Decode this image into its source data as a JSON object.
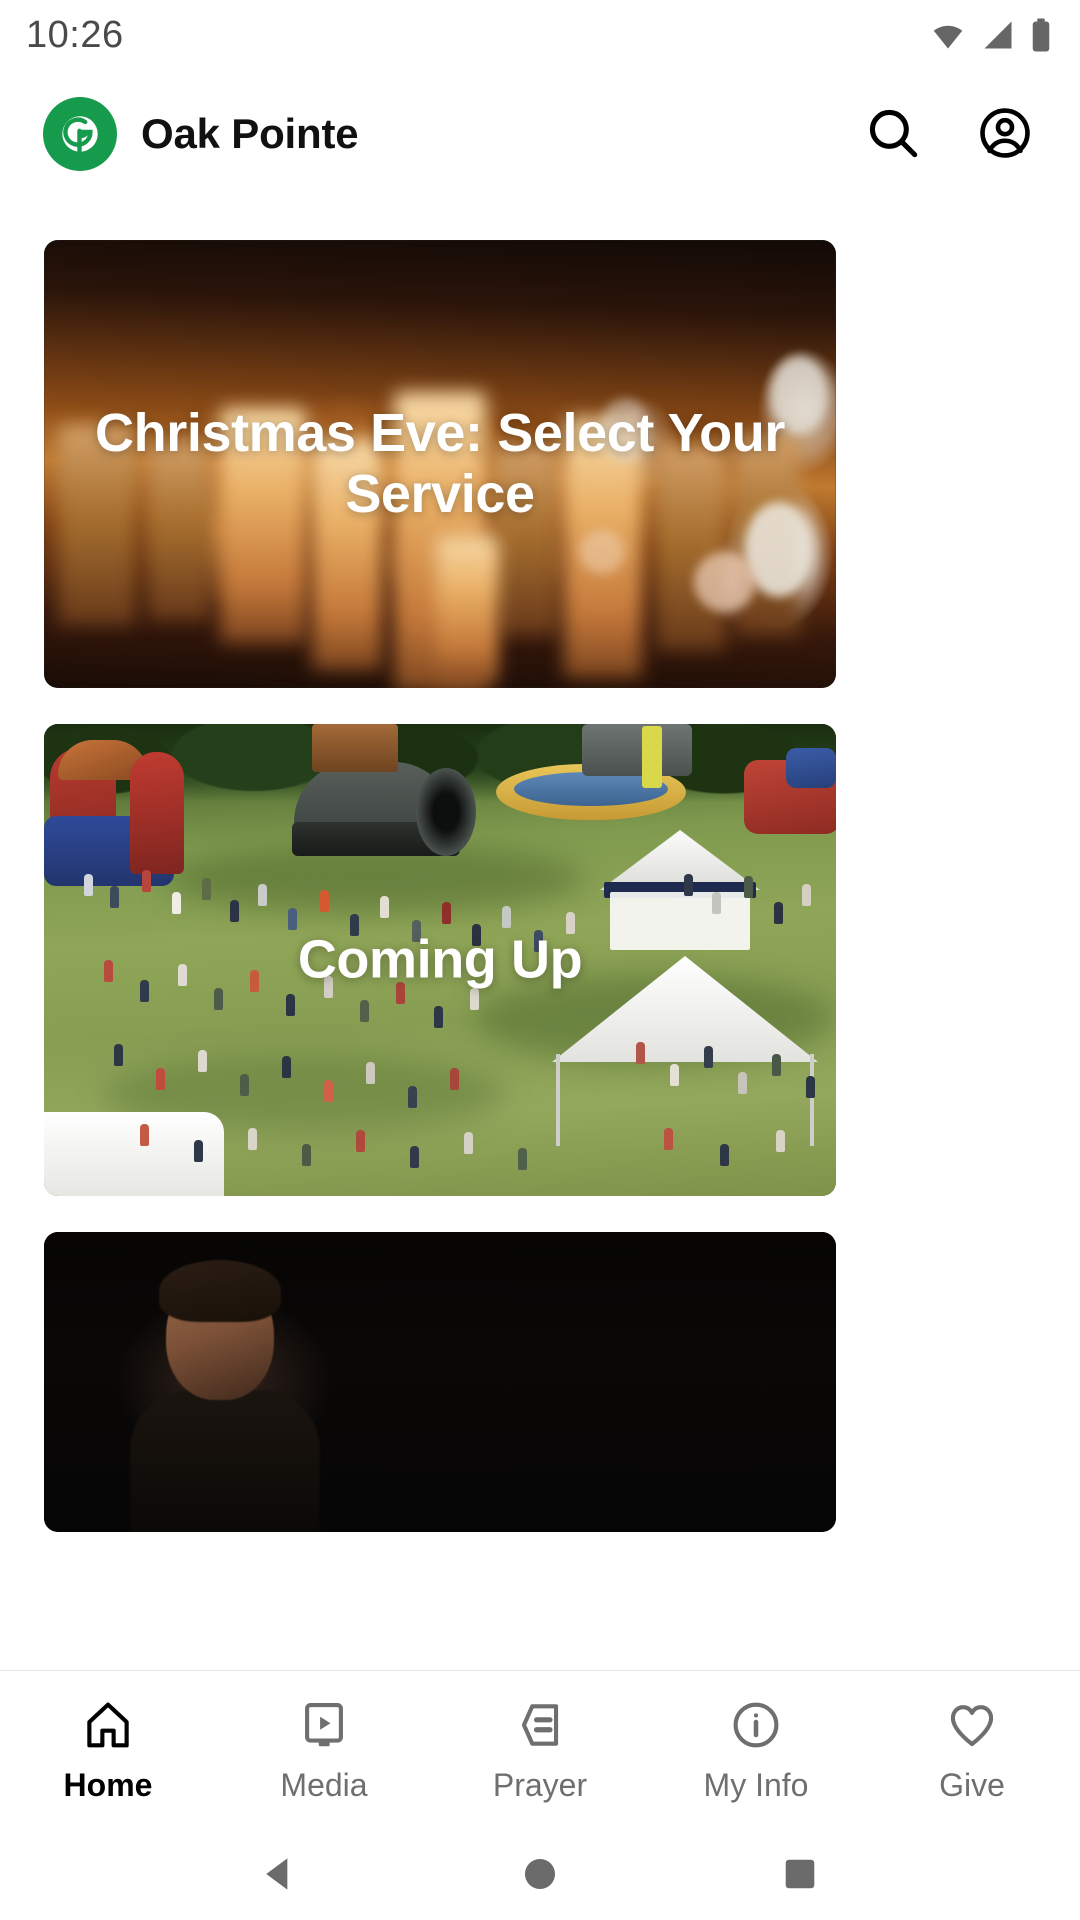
{
  "status_bar": {
    "clock": "10:26",
    "icons": [
      "wifi-icon",
      "cellular-signal-icon",
      "battery-icon"
    ]
  },
  "header": {
    "logo_icon": "oak-pointe-leaf-logo",
    "title": "Oak Pointe",
    "brand_color": "#169b4d",
    "actions": [
      {
        "icon": "search-icon",
        "label": "Search"
      },
      {
        "icon": "account-circle-icon",
        "label": "Account"
      }
    ]
  },
  "feed": {
    "cards": [
      {
        "title": "Christmas Eve: Select Your Service",
        "image_description": "blurred warm candlelight with bokeh"
      },
      {
        "title": "Coming Up",
        "image_description": "aerial view of outdoor church festival crowd on grass with inflatables and white tents"
      },
      {
        "title": "",
        "image_description": "dark stage portrait of a speaker"
      }
    ]
  },
  "bottom_nav": {
    "active_index": 0,
    "items": [
      {
        "label": "Home",
        "icon": "home-icon"
      },
      {
        "label": "Media",
        "icon": "media-play-icon"
      },
      {
        "label": "Prayer",
        "icon": "prayer-note-icon"
      },
      {
        "label": "My Info",
        "icon": "info-circle-icon"
      },
      {
        "label": "Give",
        "icon": "heart-icon"
      }
    ],
    "active_color": "#000000",
    "inactive_color": "#6f6f6f"
  },
  "system_nav": {
    "buttons": [
      {
        "name": "back-button",
        "icon": "triangle-back-icon"
      },
      {
        "name": "home-button",
        "icon": "circle-home-icon"
      },
      {
        "name": "recents-button",
        "icon": "square-recents-icon"
      }
    ]
  }
}
